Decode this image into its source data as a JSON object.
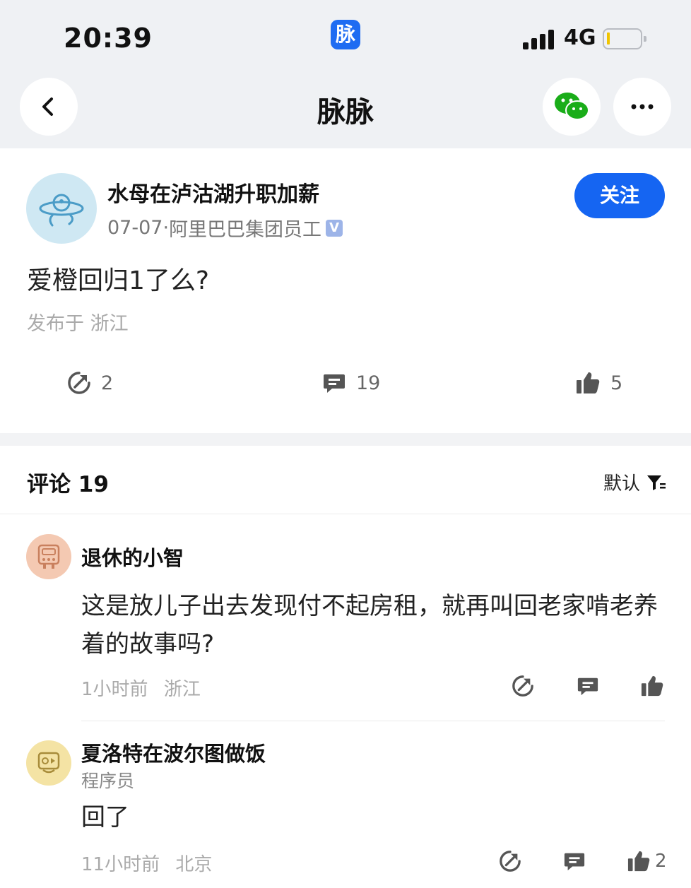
{
  "status_bar": {
    "time": "20:39",
    "app_icon_char": "脉",
    "network": "4G"
  },
  "nav": {
    "title": "脉脉",
    "icons": [
      "back-icon",
      "wechat-icon",
      "more-icon"
    ]
  },
  "post": {
    "author_name": "水母在泸沽湖升职加薪",
    "date": "07-07",
    "separator": "·",
    "company": "阿里巴巴集团员工",
    "verified_mark": "V",
    "follow_label": "关注",
    "text": "爱橙回归1了么?",
    "location": "发布于 浙江",
    "stats": {
      "shares": "2",
      "comments": "19",
      "likes": "5"
    }
  },
  "comments_header": {
    "title": "评论 19",
    "sort_label": "默认"
  },
  "comments": [
    {
      "name": "退休的小智",
      "text": "这是放儿子出去发现付不起房租，就再叫回老家啃老养着的故事吗?",
      "time": "1小时前",
      "location": "浙江",
      "likes": ""
    },
    {
      "name": "夏洛特在波尔图做饭",
      "role": "程序员",
      "text": "回了",
      "time": "11小时前",
      "location": "北京",
      "likes": "2"
    }
  ],
  "colors": {
    "accent": "#1565f2",
    "header_bg": "#eff1f4",
    "wechat_green": "#1aad19"
  }
}
